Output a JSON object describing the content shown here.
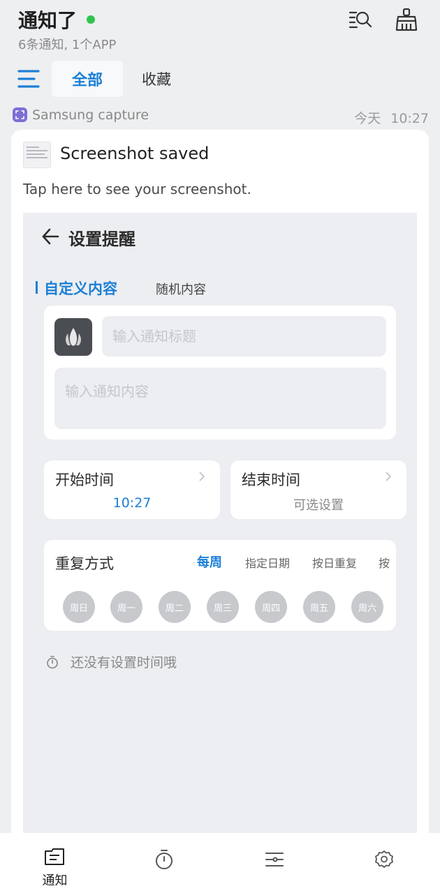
{
  "header": {
    "title": "通知了",
    "subtitle": "6条通知, 1个APP",
    "tabs": [
      {
        "label": "全部",
        "active": true
      },
      {
        "label": "收藏",
        "active": false
      }
    ]
  },
  "notification": {
    "app_name": "Samsung capture",
    "day": "今天",
    "time": "10:27",
    "title": "Screenshot saved",
    "text": "Tap here to see your screenshot."
  },
  "screenshot": {
    "title": "设置提醒",
    "tabs": [
      "自定义内容",
      "随机内容"
    ],
    "title_placeholder": "输入通知标题",
    "content_placeholder": "输入通知内容",
    "start_label": "开始时间",
    "start_value": "10:27",
    "end_label": "结束时间",
    "end_value": "可选设置",
    "repeat_label": "重复方式",
    "repeat_options": [
      "每周",
      "指定日期",
      "按日重复",
      "按"
    ],
    "days": [
      "周日",
      "周一",
      "周二",
      "周三",
      "周四",
      "周五",
      "周六"
    ],
    "empty_hint": "还没有设置时间哦"
  },
  "bottom_nav": {
    "notice_label": "通知"
  },
  "colors": {
    "accent": "#1b7fd6",
    "status_dot": "#2fc44f",
    "app_badge": "#7b6fd6",
    "background": "#eeeff1"
  }
}
